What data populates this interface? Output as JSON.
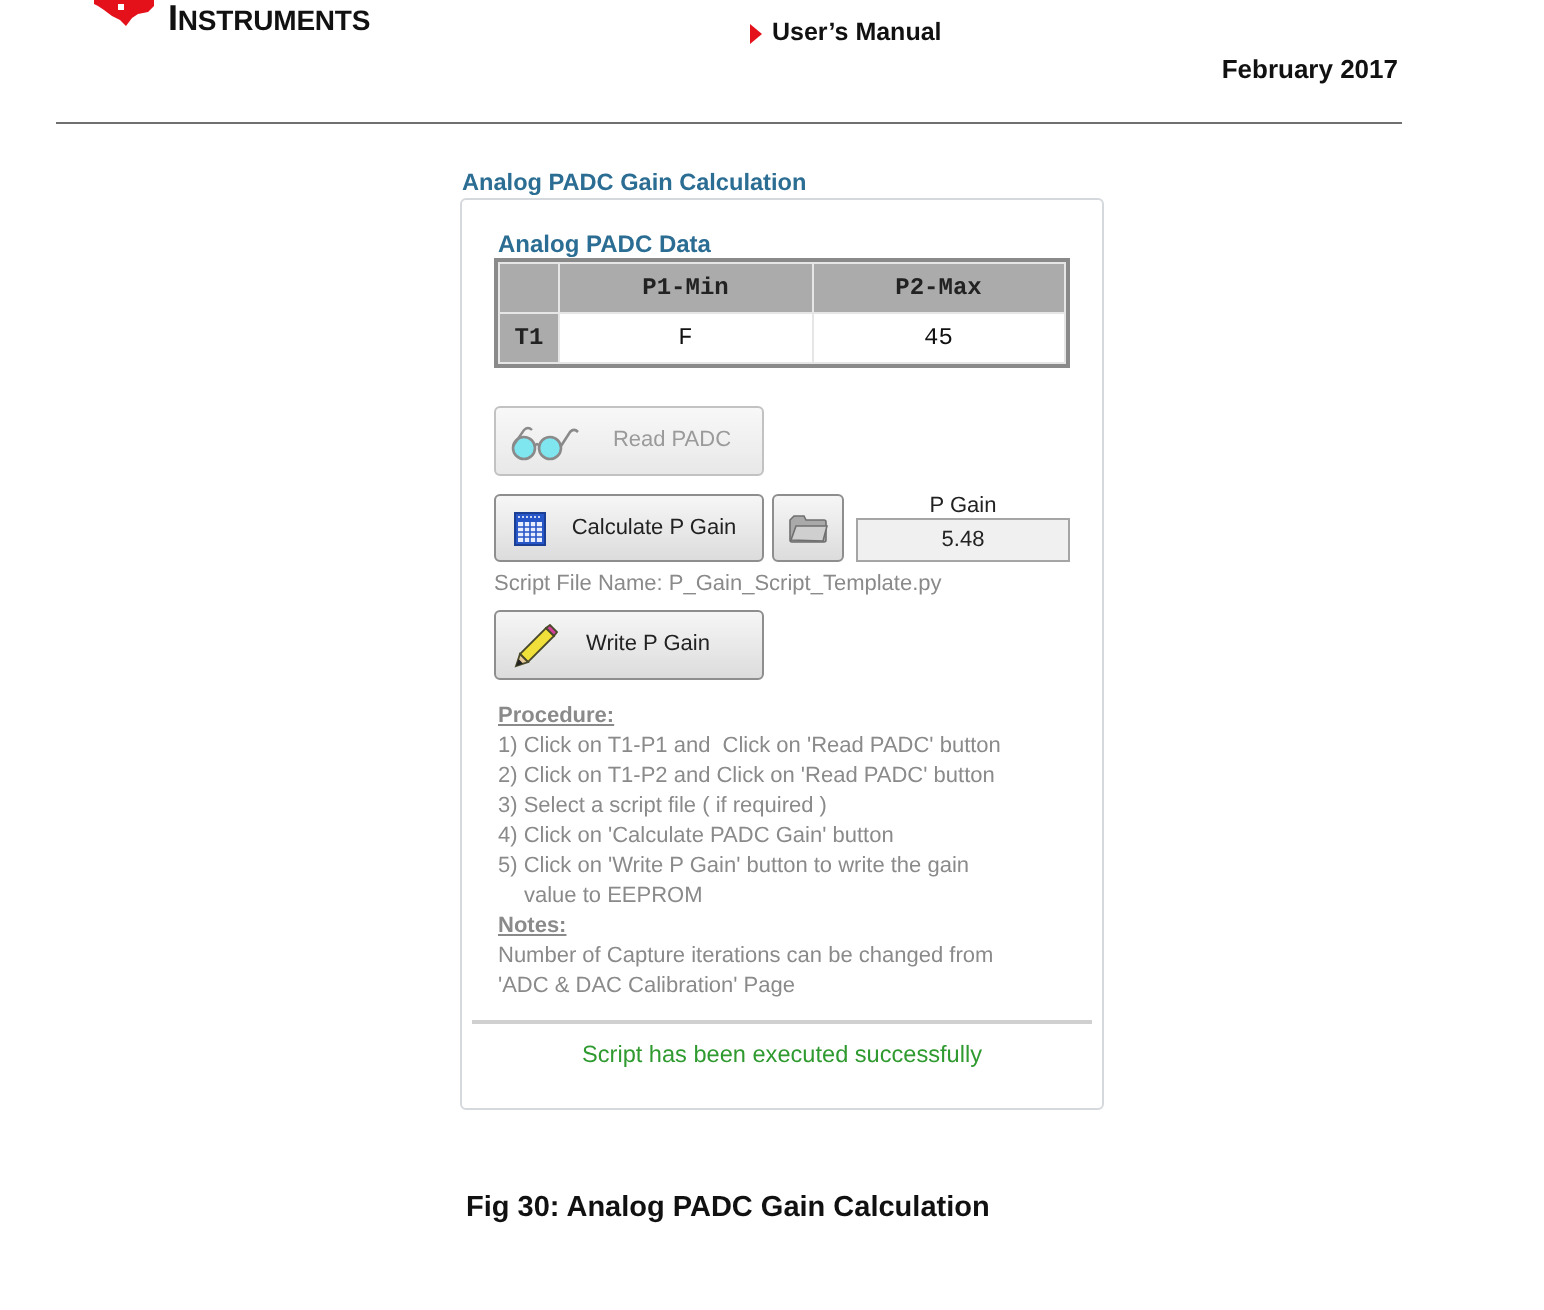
{
  "header": {
    "logo_text": "INSTRUMENTS",
    "document_title": "User’s Manual",
    "date": "February 2017"
  },
  "panel": {
    "title": "Analog PADC Gain Calculation",
    "data_table": {
      "title": "Analog PADC Data",
      "columns": [
        "P1-Min",
        "P2-Max"
      ],
      "rows": [
        {
          "label": "T1",
          "cells": [
            "F",
            "45"
          ]
        }
      ]
    },
    "read_button": {
      "label": "Read PADC",
      "disabled": true
    },
    "calculate_button": {
      "label": "Calculate P Gain",
      "disabled": false
    },
    "p_gain": {
      "label": "P Gain",
      "value": "5.48"
    },
    "script_file": "Script File Name: P_Gain_Script_Template.py",
    "write_button": {
      "label": "Write P Gain",
      "disabled": false
    },
    "procedure": {
      "heading": "Procedure:",
      "steps": [
        "1) Click on T1-P1 and  Click on 'Read PADC' button",
        "2) Click on T1-P2 and Click on 'Read PADC' button",
        "3) Select a script file ( if required )",
        "4) Click on 'Calculate PADC Gain' button",
        "5) Click on 'Write P Gain' button to write the gain value to EEPROM"
      ]
    },
    "notes": {
      "heading": "Notes:",
      "text": "Number of Capture iterations can be changed from 'ADC & DAC Calibration' Page"
    },
    "status": "Script has been executed successfully"
  },
  "caption": "Fig 30: Analog PADC Gain Calculation"
}
